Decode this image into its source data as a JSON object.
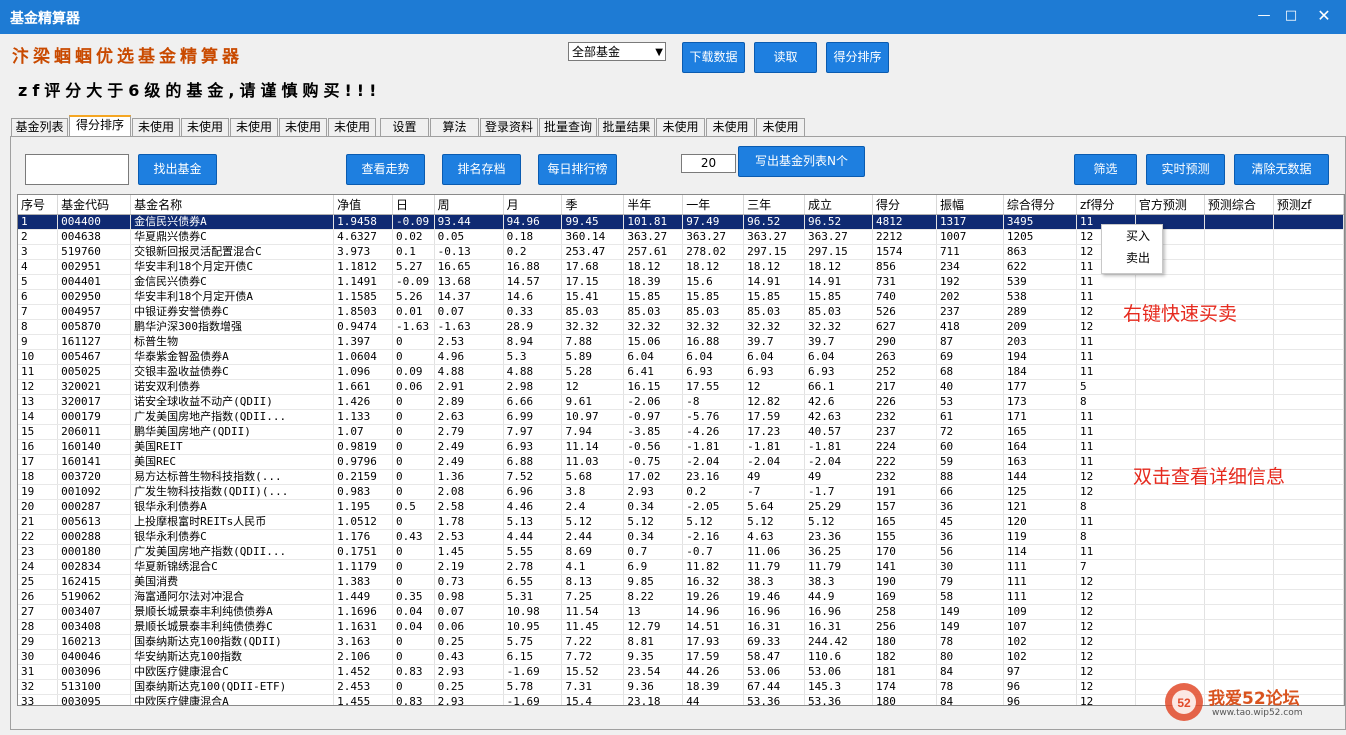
{
  "window": {
    "title": "基金精算器"
  },
  "header": {
    "heading": "汴梁蝈蝈优选基金精算器",
    "warning": "zf评分大于6级的基金,请谨慎购买!!!",
    "fund_type_select": "全部基金",
    "download_label": "下载数据",
    "read_label": "读取",
    "score_sort_label": "得分排序"
  },
  "tabs": [
    "基金列表",
    "得分排序",
    "未使用",
    "未使用",
    "未使用",
    "未使用",
    "未使用",
    "设置",
    "算法",
    "登录资料",
    "批量查询",
    "批量结果",
    "未使用",
    "未使用",
    "未使用"
  ],
  "active_tab": 1,
  "toolbar": {
    "search_value": "",
    "find_label": "找出基金",
    "trend_label": "查看走势",
    "rank_save_label": "排名存档",
    "daily_rank_label": "每日排行榜",
    "count_value": "20",
    "write_list_label": "写出基金列表N个",
    "filter_label": "筛选",
    "realtime_label": "实时预测",
    "clear_label": "清除无数据"
  },
  "table": {
    "columns": [
      "序号",
      "基金代码",
      "基金名称",
      "净值",
      "日",
      "周",
      "月",
      "季",
      "半年",
      "一年",
      "三年",
      "成立",
      "得分",
      "振幅",
      "综合得分",
      "zf得分",
      "官方预测",
      "预测综合",
      "预测zf"
    ],
    "selected_row": 0,
    "rows": [
      [
        "1",
        "004400",
        "金信民兴债券A",
        "1.9458",
        "-0.09",
        "93.44",
        "94.96",
        "99.45",
        "101.81",
        "97.49",
        "96.52",
        "96.52",
        "4812",
        "1317",
        "3495",
        "11",
        "",
        "",
        ""
      ],
      [
        "2",
        "004638",
        "华夏鼎兴债券C",
        "4.6327",
        "0.02",
        "0.05",
        "0.18",
        "360.14",
        "363.27",
        "363.27",
        "363.27",
        "363.27",
        "2212",
        "1007",
        "1205",
        "12",
        "",
        "",
        ""
      ],
      [
        "3",
        "519760",
        "交银新回报灵活配置混合C",
        "3.973",
        "0.1",
        "-0.13",
        "0.2",
        "253.47",
        "257.61",
        "278.02",
        "297.15",
        "297.15",
        "1574",
        "711",
        "863",
        "12",
        "",
        "",
        ""
      ],
      [
        "4",
        "002951",
        "华安丰利18个月定开债C",
        "1.1812",
        "5.27",
        "16.65",
        "16.88",
        "17.68",
        "18.12",
        "18.12",
        "18.12",
        "18.12",
        "856",
        "234",
        "622",
        "11",
        "",
        "",
        ""
      ],
      [
        "5",
        "004401",
        "金信民兴债券C",
        "1.1491",
        "-0.09",
        "13.68",
        "14.57",
        "17.15",
        "18.39",
        "15.6",
        "14.91",
        "14.91",
        "731",
        "192",
        "539",
        "11",
        "",
        "",
        ""
      ],
      [
        "6",
        "002950",
        "华安丰利18个月定开债A",
        "1.1585",
        "5.26",
        "14.37",
        "14.6",
        "15.41",
        "15.85",
        "15.85",
        "15.85",
        "15.85",
        "740",
        "202",
        "538",
        "11",
        "",
        "",
        ""
      ],
      [
        "7",
        "004957",
        "中银证券安誉债券C",
        "1.8503",
        "0.01",
        "0.07",
        "0.33",
        "85.03",
        "85.03",
        "85.03",
        "85.03",
        "85.03",
        "526",
        "237",
        "289",
        "12",
        "",
        "",
        ""
      ],
      [
        "8",
        "005870",
        "鹏华沪深300指数增强",
        "0.9474",
        "-1.63",
        "-1.63",
        "28.9",
        "32.32",
        "32.32",
        "32.32",
        "32.32",
        "32.32",
        "627",
        "418",
        "209",
        "12",
        "",
        "",
        ""
      ],
      [
        "9",
        "161127",
        "标普生物",
        "1.397",
        "0",
        "2.53",
        "8.94",
        "7.88",
        "15.06",
        "16.88",
        "39.7",
        "39.7",
        "290",
        "87",
        "203",
        "11",
        "",
        "",
        ""
      ],
      [
        "10",
        "005467",
        "华泰紫金智盈债券A",
        "1.0604",
        "0",
        "4.96",
        "5.3",
        "5.89",
        "6.04",
        "6.04",
        "6.04",
        "6.04",
        "263",
        "69",
        "194",
        "11",
        "",
        "",
        ""
      ],
      [
        "11",
        "005025",
        "交银丰盈收益债券C",
        "1.096",
        "0.09",
        "4.88",
        "4.88",
        "5.28",
        "6.41",
        "6.93",
        "6.93",
        "6.93",
        "252",
        "68",
        "184",
        "11",
        "",
        "",
        ""
      ],
      [
        "12",
        "320021",
        "诺安双利债券",
        "1.661",
        "0.06",
        "2.91",
        "2.98",
        "12",
        "16.15",
        "17.55",
        "12",
        "66.1",
        "217",
        "40",
        "177",
        "5",
        "",
        "",
        ""
      ],
      [
        "13",
        "320017",
        "诺安全球收益不动产(QDII)",
        "1.426",
        "0",
        "2.89",
        "6.66",
        "9.61",
        "-2.06",
        "-8",
        "12.82",
        "42.6",
        "226",
        "53",
        "173",
        "8",
        "",
        "",
        ""
      ],
      [
        "14",
        "000179",
        "广发美国房地产指数(QDII...",
        "1.133",
        "0",
        "2.63",
        "6.99",
        "10.97",
        "-0.97",
        "-5.76",
        "17.59",
        "42.63",
        "232",
        "61",
        "171",
        "11",
        "",
        "",
        ""
      ],
      [
        "15",
        "206011",
        "鹏华美国房地产(QDII)",
        "1.07",
        "0",
        "2.79",
        "7.97",
        "7.94",
        "-3.85",
        "-4.26",
        "17.23",
        "40.57",
        "237",
        "72",
        "165",
        "11",
        "",
        "",
        ""
      ],
      [
        "16",
        "160140",
        "美国REIT",
        "0.9819",
        "0",
        "2.49",
        "6.93",
        "11.14",
        "-0.56",
        "-1.81",
        "-1.81",
        "-1.81",
        "224",
        "60",
        "164",
        "11",
        "",
        "",
        ""
      ],
      [
        "17",
        "160141",
        "美国REC",
        "0.9796",
        "0",
        "2.49",
        "6.88",
        "11.03",
        "-0.75",
        "-2.04",
        "-2.04",
        "-2.04",
        "222",
        "59",
        "163",
        "11",
        "",
        "",
        ""
      ],
      [
        "18",
        "003720",
        "易方达标普生物科技指数(...",
        "0.2159",
        "0",
        "1.36",
        "7.52",
        "5.68",
        "17.02",
        "23.16",
        "49",
        "49",
        "232",
        "88",
        "144",
        "12",
        "",
        "",
        ""
      ],
      [
        "19",
        "001092",
        "广发生物科技指数(QDII)(...",
        "0.983",
        "0",
        "2.08",
        "6.96",
        "3.8",
        "2.93",
        "0.2",
        "-7",
        "-1.7",
        "191",
        "66",
        "125",
        "12",
        "",
        "",
        ""
      ],
      [
        "20",
        "000287",
        "银华永利债券A",
        "1.195",
        "0.5",
        "2.58",
        "4.46",
        "2.4",
        "0.34",
        "-2.05",
        "5.64",
        "25.29",
        "157",
        "36",
        "121",
        "8",
        "",
        "",
        ""
      ],
      [
        "21",
        "005613",
        "上投摩根富时REITs人民币",
        "1.0512",
        "0",
        "1.78",
        "5.13",
        "5.12",
        "5.12",
        "5.12",
        "5.12",
        "5.12",
        "165",
        "45",
        "120",
        "11",
        "",
        "",
        ""
      ],
      [
        "22",
        "000288",
        "银华永利债券C",
        "1.176",
        "0.43",
        "2.53",
        "4.44",
        "2.44",
        "0.34",
        "-2.16",
        "4.63",
        "23.36",
        "155",
        "36",
        "119",
        "8",
        "",
        "",
        ""
      ],
      [
        "23",
        "000180",
        "广发美国房地产指数(QDII...",
        "0.1751",
        "0",
        "1.45",
        "5.55",
        "8.69",
        "0.7",
        "-0.7",
        "11.06",
        "36.25",
        "170",
        "56",
        "114",
        "11",
        "",
        "",
        ""
      ],
      [
        "24",
        "002834",
        "华夏新锦绣混合C",
        "1.1179",
        "0",
        "2.19",
        "2.78",
        "4.1",
        "6.9",
        "11.82",
        "11.79",
        "11.79",
        "141",
        "30",
        "111",
        "7",
        "",
        "",
        ""
      ],
      [
        "25",
        "162415",
        "美国消费",
        "1.383",
        "0",
        "0.73",
        "6.55",
        "8.13",
        "9.85",
        "16.32",
        "38.3",
        "38.3",
        "190",
        "79",
        "111",
        "12",
        "",
        "",
        ""
      ],
      [
        "26",
        "519062",
        "海富通阿尔法对冲混合",
        "1.449",
        "0.35",
        "0.98",
        "5.31",
        "7.25",
        "8.22",
        "19.26",
        "19.46",
        "44.9",
        "169",
        "58",
        "111",
        "12",
        "",
        "",
        ""
      ],
      [
        "27",
        "003407",
        "景顺长城景泰丰利纯债债券A",
        "1.1696",
        "0.04",
        "0.07",
        "10.98",
        "11.54",
        "13",
        "14.96",
        "16.96",
        "16.96",
        "258",
        "149",
        "109",
        "12",
        "",
        "",
        ""
      ],
      [
        "28",
        "003408",
        "景顺长城景泰丰利纯债债券C",
        "1.1631",
        "0.04",
        "0.06",
        "10.95",
        "11.45",
        "12.79",
        "14.51",
        "16.31",
        "16.31",
        "256",
        "149",
        "107",
        "12",
        "",
        "",
        ""
      ],
      [
        "29",
        "160213",
        "国泰纳斯达克100指数(QDII)",
        "3.163",
        "0",
        "0.25",
        "5.75",
        "7.22",
        "8.81",
        "17.93",
        "69.33",
        "244.42",
        "180",
        "78",
        "102",
        "12",
        "",
        "",
        ""
      ],
      [
        "30",
        "040046",
        "华安纳斯达克100指数",
        "2.106",
        "0",
        "0.43",
        "6.15",
        "7.72",
        "9.35",
        "17.59",
        "58.47",
        "110.6",
        "182",
        "80",
        "102",
        "12",
        "",
        "",
        ""
      ],
      [
        "31",
        "003096",
        "中欧医疗健康混合C",
        "1.452",
        "0.83",
        "2.93",
        "-1.69",
        "15.52",
        "23.54",
        "44.26",
        "53.06",
        "53.06",
        "181",
        "84",
        "97",
        "12",
        "",
        "",
        ""
      ],
      [
        "32",
        "513100",
        "国泰纳斯达克100(QDII-ETF)",
        "2.453",
        "0",
        "0.25",
        "5.78",
        "7.31",
        "9.36",
        "18.39",
        "67.44",
        "145.3",
        "174",
        "78",
        "96",
        "12",
        "",
        "",
        ""
      ],
      [
        "33",
        "003095",
        "中欧医疗健康混合A",
        "1.455",
        "0.83",
        "2.93",
        "-1.69",
        "15.4",
        "23.18",
        "44",
        "53.36",
        "53.36",
        "180",
        "84",
        "96",
        "12",
        "",
        "",
        ""
      ]
    ]
  },
  "context_menu": {
    "buy": "买入",
    "sell": "卖出"
  },
  "notes": {
    "right_click": "右键快速买卖",
    "double_click": "双击查看详细信息"
  },
  "watermark": {
    "text": "我爱52论坛",
    "url": "www.tao.wip52.com"
  },
  "colors": {
    "accent": "#1e7bd4",
    "button": "#1e7fe0",
    "selected_row": "#0f2a72",
    "note_red": "#e62a1e",
    "heading_orange": "#c94a00"
  }
}
